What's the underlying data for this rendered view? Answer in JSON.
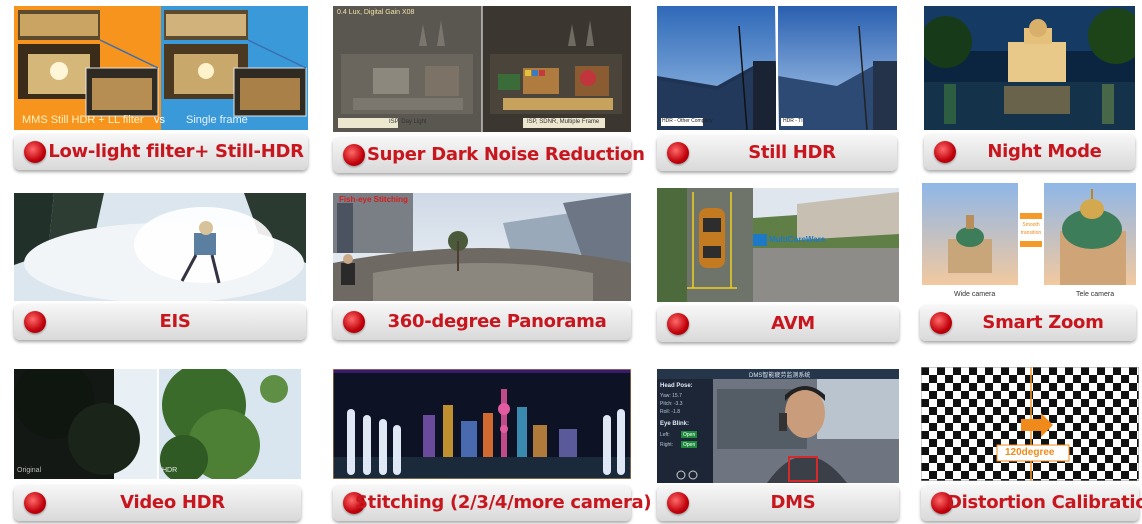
{
  "tiles": [
    {
      "label": "Low-light filter+ Still-HDR",
      "captions": {
        "left": "MMS Still HDR + LL filter",
        "vs": "vs",
        "right": "Single frame"
      }
    },
    {
      "label": "Super Dark Noise Reduction",
      "captions": {
        "top": "0.4 Lux, Digital Gain X08",
        "left": "ISP, Day Light",
        "right": "ISP, SDNR, Multiple Frame"
      }
    },
    {
      "label": "Still HDR",
      "captions": {
        "left": "HDR - Other Company",
        "right": "HDR - TI"
      }
    },
    {
      "label": "Night Mode"
    },
    {
      "label": "EIS"
    },
    {
      "label": "360-degree Panorama",
      "captions": {
        "title": "Fish-eye Stitching"
      }
    },
    {
      "label": "AVM",
      "captions": {
        "logo": "MultiCoreWare"
      }
    },
    {
      "label": "Smart Zoom",
      "captions": {
        "middle": "Smooth transition",
        "left": "Wide camera",
        "right": "Tele camera"
      }
    },
    {
      "label": "Video HDR",
      "captions": {
        "left": "Original",
        "right": "HDR"
      }
    },
    {
      "label": "Stitching (2/3/4/more camera)"
    },
    {
      "label": "DMS",
      "captions": {
        "title": "DMS智能疲劳监测系统",
        "head": "Head Pose:",
        "yaw": "Yaw: 15.7",
        "pitch": "Pitch: -3.3",
        "roll": "Roll: -1.8",
        "eye": "Eye Blink:",
        "eyeleft": "Left:",
        "eyeright": "Right:",
        "open": "Open"
      }
    },
    {
      "label": "Distortion Calibration",
      "captions": {
        "angle": "120degree"
      }
    }
  ],
  "colors": {
    "label": "#c8161e",
    "dot": "#c0000a"
  }
}
